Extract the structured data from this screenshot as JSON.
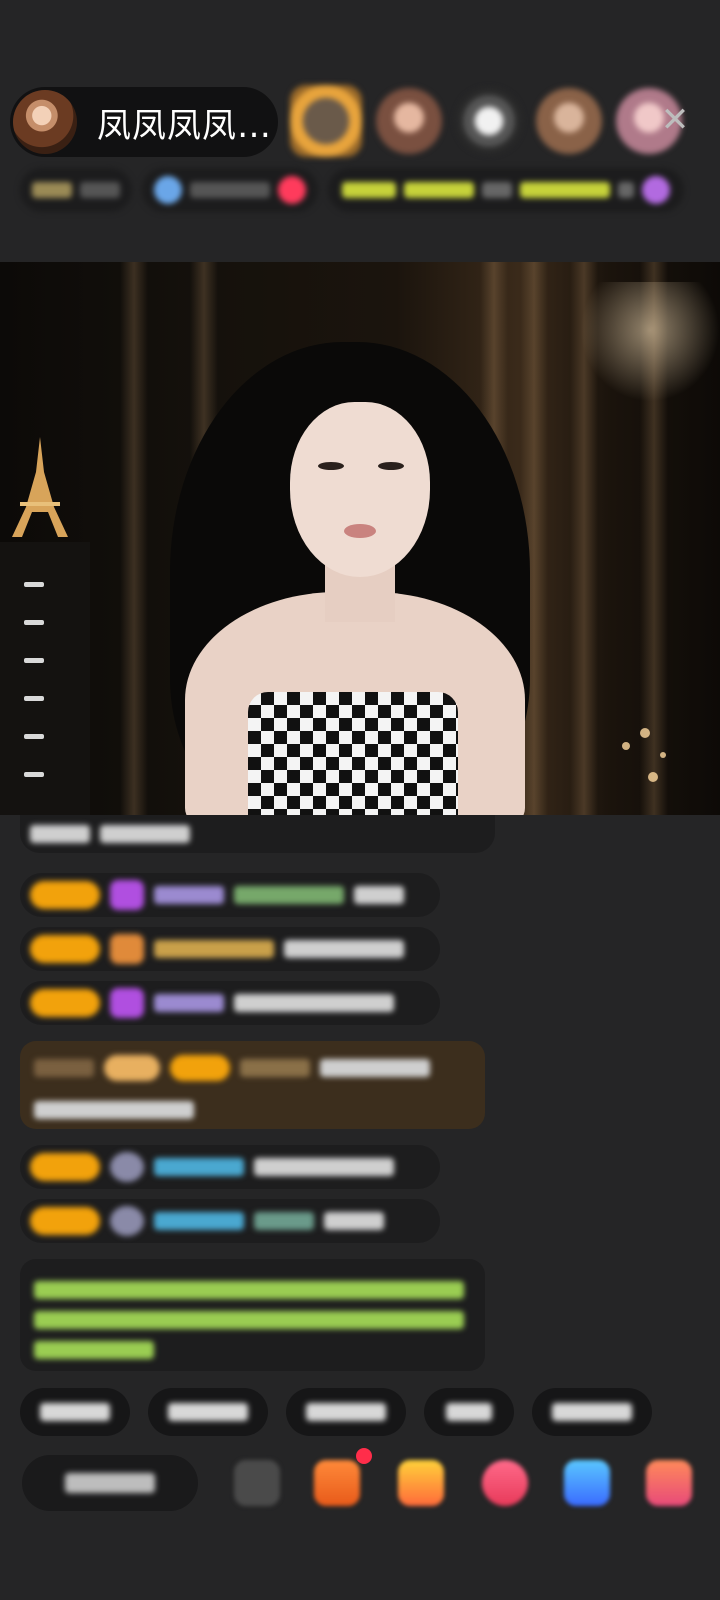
{
  "header": {
    "host_name": "凤凤凤凤…",
    "close_label": "✕"
  },
  "colors": {
    "background": "#252526",
    "badge_gold": "#f2a20c",
    "highlight_bar": "#3c2e1d",
    "system_text": "#9acd52"
  },
  "icons": {
    "close": "close-icon",
    "emoji": "emoji-icon",
    "gift": "gift-icon",
    "more": "more-icon"
  }
}
